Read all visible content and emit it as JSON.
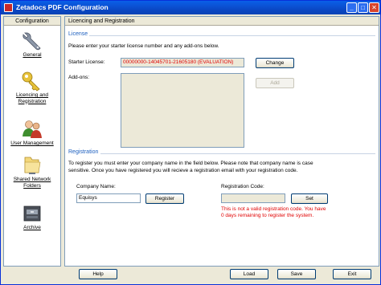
{
  "window": {
    "title": "Zetadocs PDF Configuration",
    "min": "_",
    "max": "□",
    "close": "✕"
  },
  "nav": {
    "header": "Configuration",
    "items": [
      {
        "label": "General",
        "icon": "wrench-icon"
      },
      {
        "label": "Licencing and Registration",
        "icon": "key-icon"
      },
      {
        "label": "User Management",
        "icon": "users-icon"
      },
      {
        "label": "Shared Network Folders",
        "icon": "folder-icon"
      },
      {
        "label": "Archive",
        "icon": "archive-icon"
      }
    ]
  },
  "main": {
    "header": "Licencing and Registration",
    "license": {
      "group_label": "License",
      "instructions": "Please enter your starter license number and any add-ons below.",
      "starter_label": "Starter License:",
      "starter_value": "00000000-14045701-21605180 (EVALUATION)",
      "change_button": "Change",
      "addons_label": "Add-ons:",
      "add_button": "Add"
    },
    "registration": {
      "group_label": "Registration",
      "instructions_line1": "To register you must enter your company name in the field below. Please note that company name is case",
      "instructions_line2": "sensitive. Once you have registered you will recieve a registration email with your registration code.",
      "company_label": "Company Name:",
      "company_value": "Equisys",
      "register_button": "Register",
      "code_label": "Registration Code:",
      "code_value": "",
      "set_button": "Set",
      "error_line1": "This is not a valid registration code. You have",
      "error_line2": "0 days remaining to register the system."
    }
  },
  "footer": {
    "help": "Help",
    "load": "Load",
    "save": "Save",
    "exit": "Exit"
  },
  "colors": {
    "error": "#e00000",
    "group_label": "#1c5fbf",
    "title_bar": "#0a52d8"
  }
}
